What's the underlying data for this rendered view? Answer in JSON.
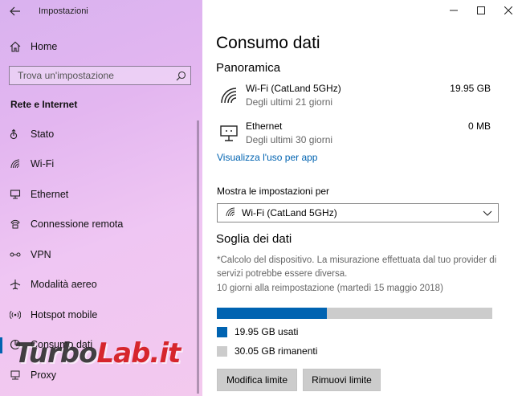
{
  "window": {
    "app_title": "Impostazioni",
    "controls": {
      "minimize": "—",
      "maximize": "☐",
      "close": "✕"
    }
  },
  "sidebar": {
    "home_label": "Home",
    "search_placeholder": "Trova un'impostazione",
    "section_title": "Rete e Internet",
    "items": [
      {
        "label": "Stato",
        "icon": "status-icon"
      },
      {
        "label": "Wi-Fi",
        "icon": "wifi-icon"
      },
      {
        "label": "Ethernet",
        "icon": "ethernet-icon"
      },
      {
        "label": "Connessione remota",
        "icon": "dialup-icon"
      },
      {
        "label": "VPN",
        "icon": "vpn-icon"
      },
      {
        "label": "Modalità aereo",
        "icon": "airplane-icon"
      },
      {
        "label": "Hotspot mobile",
        "icon": "hotspot-icon"
      },
      {
        "label": "Consumo dati",
        "icon": "data-usage-icon",
        "active": true
      },
      {
        "label": "Proxy",
        "icon": "proxy-icon"
      }
    ]
  },
  "main": {
    "title": "Consumo dati",
    "overview_heading": "Panoramica",
    "usage": [
      {
        "name": "Wi-Fi (CatLand 5GHz)",
        "period": "Degli ultimi 21 giorni",
        "amount": "19.95 GB"
      },
      {
        "name": "Ethernet",
        "period": "Degli ultimi 30 giorni",
        "amount": "0 MB"
      }
    ],
    "per_app_link": "Visualizza l'uso per app",
    "settings_for_label": "Mostra le impostazioni per",
    "settings_for_value": "Wi-Fi (CatLand 5GHz)",
    "limit_heading": "Soglia dei dati",
    "limit_note": "*Calcolo del dispositivo. La misurazione effettuata dal tuo provider di servizi potrebbe essere diversa.",
    "reset_text": "10 giorni alla reimpostazione (martedì 15 maggio 2018)",
    "used_fraction": 0.399,
    "used_label": "19.95 GB usati",
    "remaining_label": "30.05 GB rimanenti",
    "edit_limit_button": "Modifica limite",
    "remove_limit_button": "Rimuovi limite"
  },
  "colors": {
    "accent": "#0063b1",
    "bar_remaining": "#cccccc"
  },
  "watermark": {
    "part1": "Turbo",
    "part2": "Lab.it"
  }
}
